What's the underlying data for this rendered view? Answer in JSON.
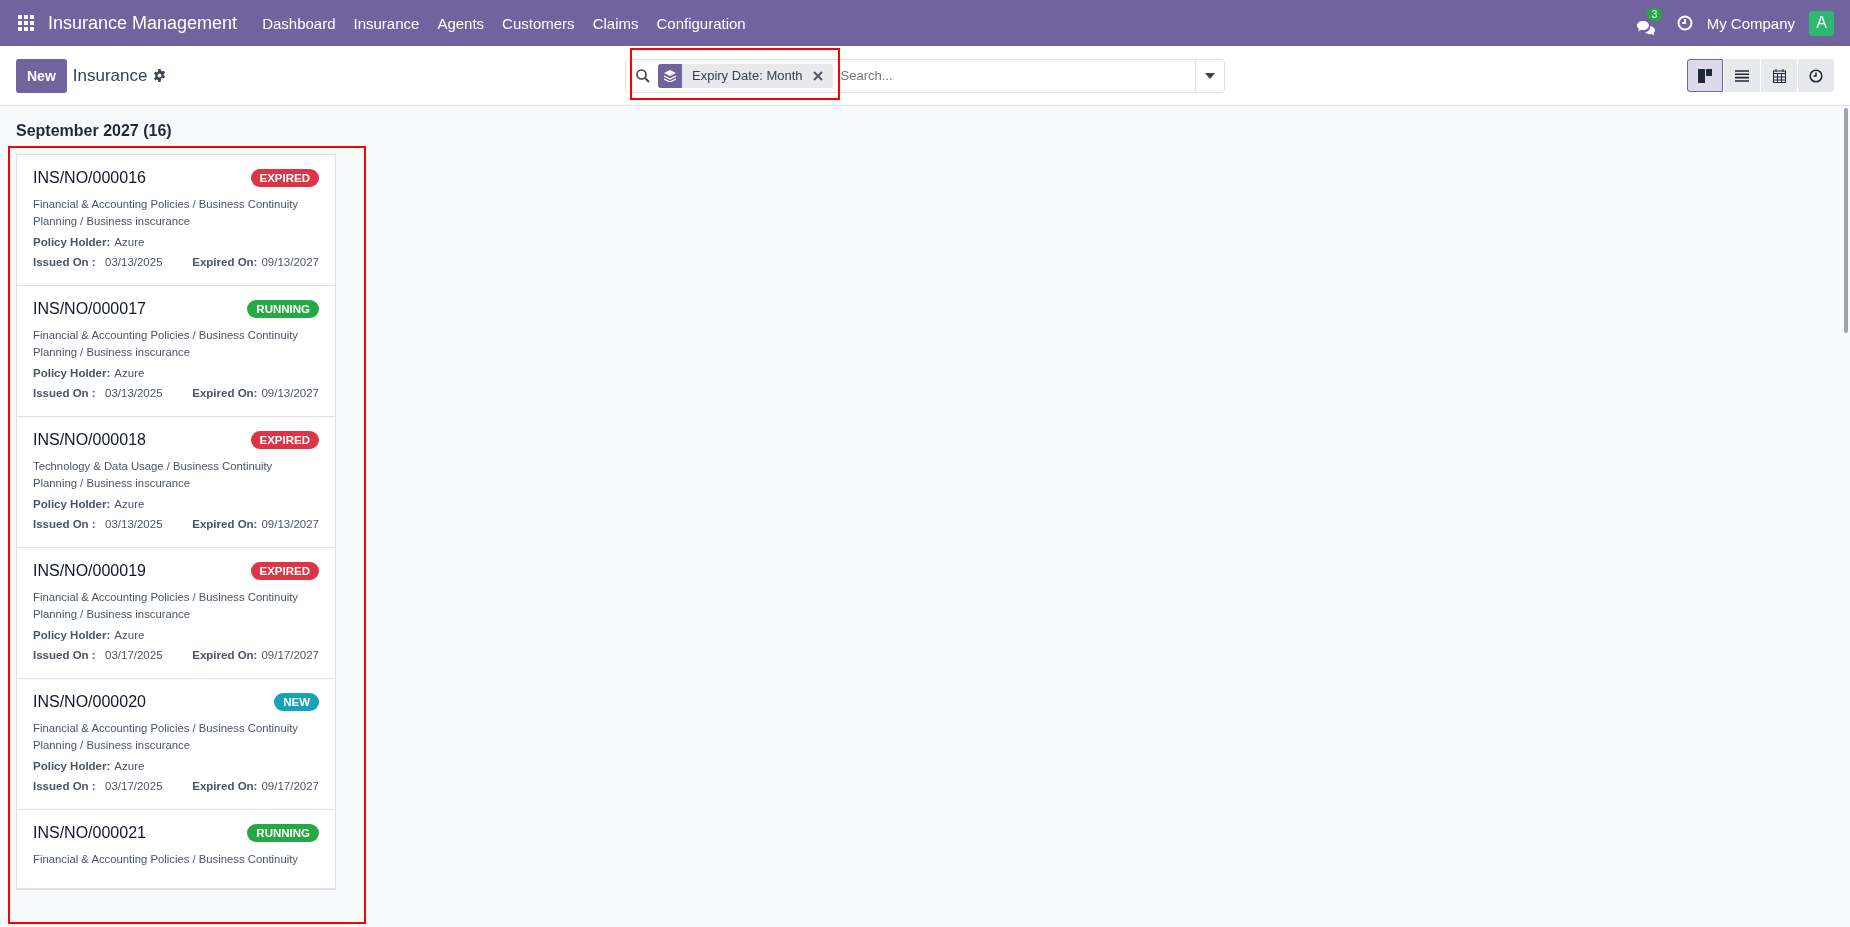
{
  "navbar": {
    "app_title": "Insurance Management",
    "menu": [
      "Dashboard",
      "Insurance",
      "Agents",
      "Customers",
      "Claims",
      "Configuration"
    ],
    "messages_count": "3",
    "company": "My Company",
    "avatar_initial": "A"
  },
  "control_panel": {
    "new_button": "New",
    "breadcrumb": "Insurance",
    "search": {
      "facets": [
        {
          "label": "Expiry Date: Month"
        }
      ],
      "placeholder": "Search..."
    },
    "views": [
      {
        "kind": "kanban",
        "selected": true
      },
      {
        "kind": "list",
        "selected": false
      },
      {
        "kind": "calendar",
        "selected": false
      },
      {
        "kind": "activity",
        "selected": false
      }
    ]
  },
  "group": {
    "title": "September 2027 (16)",
    "cards": [
      {
        "reference": "INS/NO/000016",
        "kind": "expired",
        "status_label": "EXPIRED",
        "description": "Financial & Accounting Policies / Business Continuity Planning / Business inscurance",
        "holder_label": "Policy Holder:",
        "holder": "Azure",
        "issued_label": "Issued On :",
        "issued": "03/13/2025",
        "expired_label": "Expired On:",
        "expired": "09/13/2027"
      },
      {
        "reference": "INS/NO/000017",
        "kind": "running",
        "status_label": "RUNNING",
        "description": "Financial & Accounting Policies / Business Continuity Planning / Business inscurance",
        "holder_label": "Policy Holder:",
        "holder": "Azure",
        "issued_label": "Issued On :",
        "issued": "03/13/2025",
        "expired_label": "Expired On:",
        "expired": "09/13/2027"
      },
      {
        "reference": "INS/NO/000018",
        "kind": "expired",
        "status_label": "EXPIRED",
        "description": "Technology & Data Usage / Business Continuity Planning / Business inscurance",
        "holder_label": "Policy Holder:",
        "holder": "Azure",
        "issued_label": "Issued On :",
        "issued": "03/13/2025",
        "expired_label": "Expired On:",
        "expired": "09/13/2027"
      },
      {
        "reference": "INS/NO/000019",
        "kind": "expired",
        "status_label": "EXPIRED",
        "description": "Financial & Accounting Policies / Business Continuity Planning / Business inscurance",
        "holder_label": "Policy Holder:",
        "holder": "Azure",
        "issued_label": "Issued On :",
        "issued": "03/17/2025",
        "expired_label": "Expired On:",
        "expired": "09/17/2027"
      },
      {
        "reference": "INS/NO/000020",
        "kind": "new",
        "status_label": "NEW",
        "description": "Financial & Accounting Policies / Business Continuity Planning / Business inscurance",
        "holder_label": "Policy Holder:",
        "holder": "Azure",
        "issued_label": "Issued On :",
        "issued": "03/17/2025",
        "expired_label": "Expired On:",
        "expired": "09/17/2027"
      },
      {
        "reference": "INS/NO/000021",
        "kind": "running",
        "status_label": "RUNNING",
        "description": "Financial & Accounting Policies / Business Continuity"
      }
    ]
  }
}
